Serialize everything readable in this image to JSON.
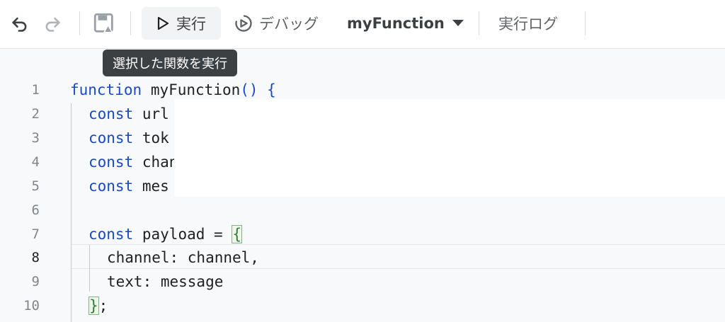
{
  "toolbar": {
    "undo_icon": "undo-icon",
    "redo_icon": "redo-icon",
    "save_icon": "save-to-drive-icon",
    "run_label": "実行",
    "debug_label": "デバッグ",
    "function_select": "myFunction",
    "log_label": "実行ログ"
  },
  "tooltip": {
    "text": "選択した関数を実行"
  },
  "editor": {
    "lines": [
      {
        "num": "1"
      },
      {
        "num": "2",
        "text": "url"
      },
      {
        "num": "3",
        "text": "tok"
      },
      {
        "num": "4",
        "text": "chan"
      },
      {
        "num": "5",
        "text": "mes"
      },
      {
        "num": "6"
      },
      {
        "num": "7"
      },
      {
        "num": "8"
      },
      {
        "num": "9"
      },
      {
        "num": "10"
      }
    ],
    "kw_function": "function",
    "fn_name": "myFunction",
    "paren_brace": "() {",
    "kw_const": "const",
    "payload_decl": "payload = ",
    "open_brace": "{",
    "channel_line": "channel: channel,",
    "text_line": "text: message",
    "close_brace": "}",
    "semicolon": ";"
  }
}
